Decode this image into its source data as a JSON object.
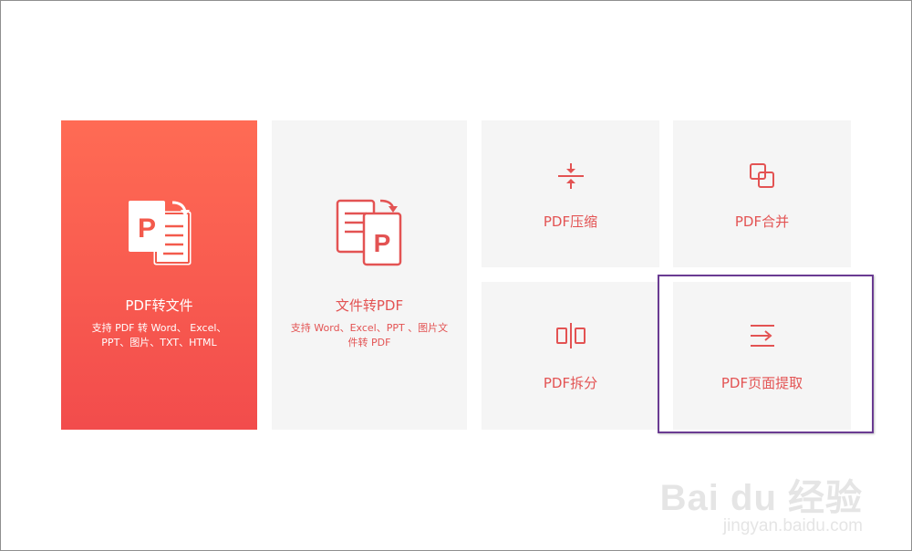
{
  "cards": {
    "pdf_to_file": {
      "title": "PDF转文件",
      "desc_line1": "支持 PDF 转 Word、 Excel、",
      "desc_line2": "PPT、图片、TXT、HTML",
      "icon": "pdf-to-file-icon"
    },
    "file_to_pdf": {
      "title": "文件转PDF",
      "desc_line1": "支持 Word、Excel、PPT 、图片文",
      "desc_line2": "件转 PDF",
      "icon": "file-to-pdf-icon"
    },
    "compress": {
      "title": "PDF压缩",
      "icon": "compress-icon"
    },
    "merge": {
      "title": "PDF合并",
      "icon": "merge-icon"
    },
    "split": {
      "title": "PDF拆分",
      "icon": "split-icon"
    },
    "extract": {
      "title": "PDF页面提取",
      "icon": "extract-icon"
    }
  },
  "watermark": {
    "main": "Bai du 经验",
    "sub": "jingyan.baidu.com"
  },
  "colors": {
    "accent": "#e35353",
    "primary_gradient_top": "#ff6b54",
    "primary_gradient_bottom": "#f24c4c",
    "card_bg": "#f5f5f5",
    "highlight": "#6a3b92"
  }
}
